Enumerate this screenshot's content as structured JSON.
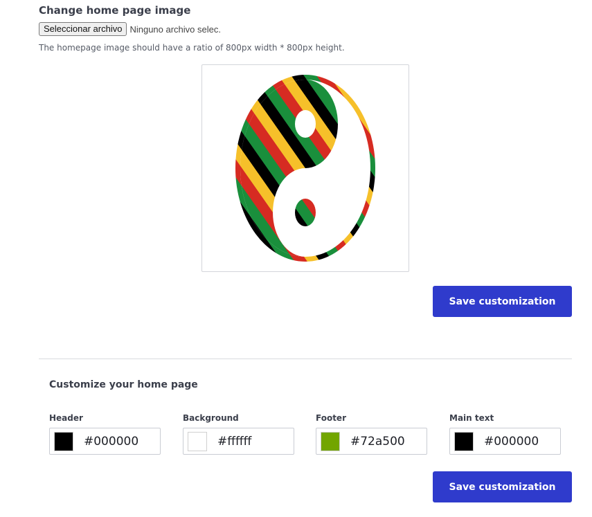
{
  "image_section": {
    "title": "Change home page image",
    "file_button_label": "Seleccionar archivo",
    "file_status": "Ninguno archivo selec.",
    "hint": "The homepage image should have a ratio of 800px width * 800px height.",
    "preview_image": "yin-yang-striped-image",
    "save_label": "Save customization"
  },
  "customize_section": {
    "title": "Customize your home page",
    "colors": [
      {
        "label": "Header",
        "value": "#000000",
        "swatch": "#000000"
      },
      {
        "label": "Background",
        "value": "#ffffff",
        "swatch": "#ffffff"
      },
      {
        "label": "Footer",
        "value": "#72a500",
        "swatch": "#72a500"
      },
      {
        "label": "Main text",
        "value": "#000000",
        "swatch": "#000000"
      }
    ],
    "save_label": "Save customization"
  },
  "theme": {
    "button_color": "#2f3bcc",
    "stripe_colors": [
      "#000000",
      "#1a8f3c",
      "#d62b22",
      "#f6c02a"
    ]
  }
}
